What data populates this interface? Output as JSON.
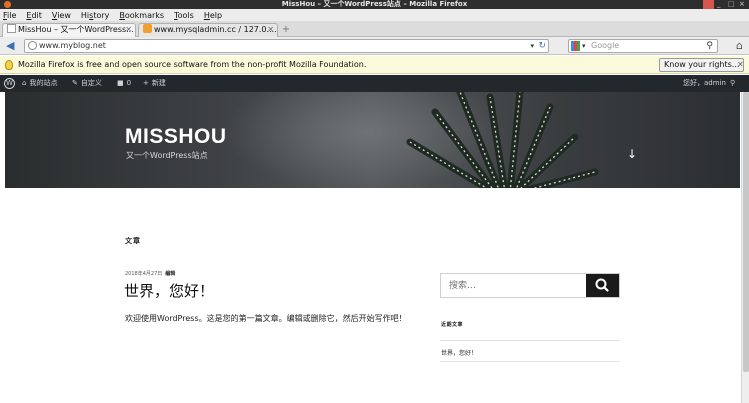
{
  "window": {
    "title": "MissHou – 又一个WordPress站点 – Mozilla Firefox",
    "controls": [
      "_",
      "□",
      "×"
    ]
  },
  "menu": {
    "items": [
      {
        "u": "F",
        "rest": "ile"
      },
      {
        "u": "E",
        "rest": "dit"
      },
      {
        "u": "V",
        "rest": "iew"
      },
      {
        "pre": "Hi",
        "u": "s",
        "rest": "tory"
      },
      {
        "u": "B",
        "rest": "ookmarks"
      },
      {
        "u": "T",
        "rest": "ools"
      },
      {
        "u": "H",
        "rest": "elp"
      }
    ]
  },
  "tabs": [
    {
      "label": "MissHou – 又一个WordPress...",
      "close": "✕",
      "active": true
    },
    {
      "label": "www.mysqladmin.cc / 127.0....",
      "close": "✕",
      "active": false
    }
  ],
  "newtab": "+",
  "nav": {
    "back": "◀",
    "url": "www.myblog.net",
    "url_dropdown": "▾",
    "reload": "↻",
    "search_placeholder": "Google",
    "engine_dropdown": "▾",
    "search_icon": "⚲",
    "home": "⌂"
  },
  "notification": {
    "text": "Mozilla Firefox is free and open source software from the non-profit Mozilla Foundation.",
    "button": "Know your rights...",
    "close": "✕"
  },
  "adminbar": {
    "wp_logo": "W",
    "site": "我的站点",
    "customize": "自定义",
    "comments_count": "0",
    "new": "新建",
    "greeting": "您好，admin",
    "search_icon": "⚲"
  },
  "site": {
    "title": "MISSHOU",
    "description": "又一个WordPress站点",
    "scroll_down": "↓"
  },
  "main": {
    "section_heading": "文章",
    "post": {
      "date": "2018年4月27日",
      "edit": "编辑",
      "title": "世界，您好！",
      "body": "欢迎使用WordPress。这是您的第一篇文章。编辑或删除它，然后开始写作吧！"
    }
  },
  "sidebar": {
    "search_placeholder": "搜索…",
    "recent_title": "近期文章",
    "recent_posts": [
      "世界，您好！"
    ]
  },
  "colors": {
    "adminbar": "#23282d",
    "search_button": "#1a1a1a",
    "notification": "#fbfbdc"
  }
}
